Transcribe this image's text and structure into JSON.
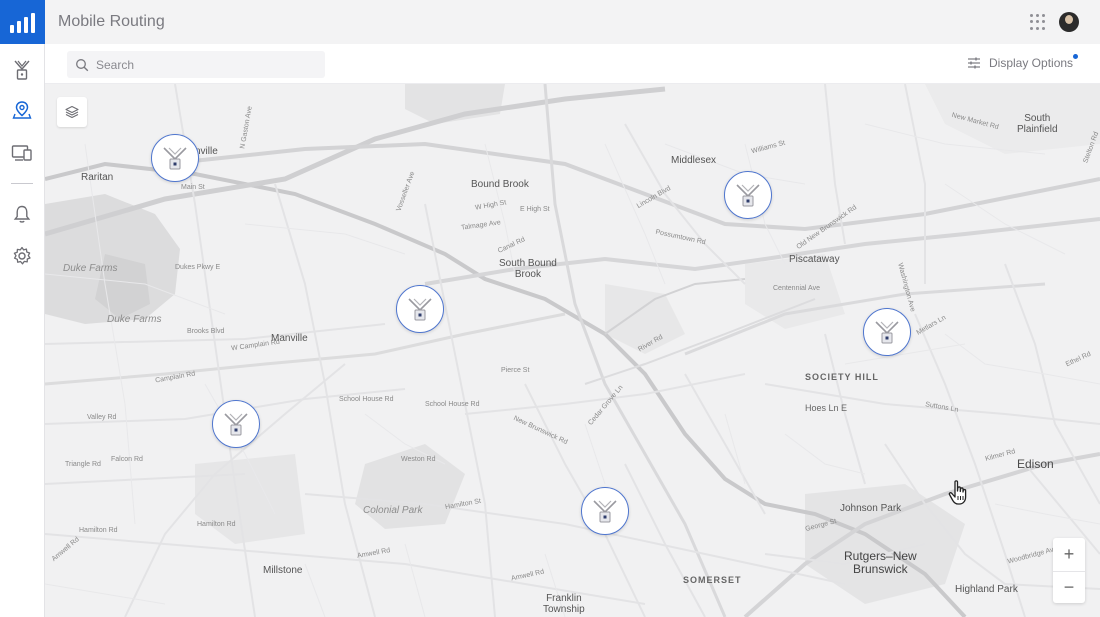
{
  "app": {
    "title": "Mobile Routing"
  },
  "brand": {
    "accent": "#1766d6",
    "marker_ring": "#4f76cf"
  },
  "sidebar": {
    "items": [
      {
        "name": "towers",
        "icon": "tower-icon"
      },
      {
        "name": "map",
        "icon": "map-pin-icon"
      },
      {
        "name": "devices",
        "icon": "devices-icon"
      },
      {
        "name": "alerts",
        "icon": "bell-icon"
      },
      {
        "name": "settings",
        "icon": "gear-icon"
      }
    ]
  },
  "header": {
    "apps_icon": "apps-grid-icon",
    "avatar": "user-avatar"
  },
  "toolbar": {
    "search_placeholder": "Search",
    "display_options_label": "Display Options"
  },
  "map": {
    "places": {
      "raritan": "Raritan",
      "manville_top": "nville",
      "bound_brook": "Bound Brook",
      "middlesex": "Middlesex",
      "south_plainfield": "South\nPlainfield",
      "south_bound_brook": "South Bound\nBrook",
      "piscataway": "Piscataway",
      "duke_farms_1": "Duke Farms",
      "duke_farms_2": "Duke Farms",
      "manville": "Manville",
      "society_hill": "SOCIETY HILL",
      "edison": "Edison",
      "colonial_park": "Colonial Park",
      "johnson_park": "Johnson Park",
      "rutgers": "Rutgers–New\nBrunswick",
      "millstone": "Millstone",
      "franklin": "Franklin\nTownship",
      "somerset": "SOMERSET",
      "highland_park": "Highland Park"
    },
    "streets": {
      "main_st": "Main St",
      "n_gaston": "N Gaston Ave",
      "e_high": "E High St",
      "w_high": "W High St",
      "talmage": "Talmage Ave",
      "canal_rd": "Canal Rd",
      "river_rd": "River Rd",
      "centennial": "Centennial Ave",
      "hoes_ln": "Hoes Ln E",
      "w_camplain": "W Camplain Rd",
      "camplain": "Camplain Rd",
      "valley_rd": "Valley Rd",
      "triangle": "Triangle Rd",
      "falcon": "Falcon Rd",
      "hamilton1": "Hamilton Rd",
      "hamilton2": "Hamilton Rd",
      "hamilton3": "Hamilton St",
      "amwell1": "Amwell Rd",
      "amwell2": "Amwell Rd",
      "amwell3": "Amwell Rd",
      "weston": "Weston Rd",
      "school_house1": "School House Rd",
      "school_house2": "School House Rd",
      "pierce": "Pierce St",
      "brooks_blvd": "Brooks Blvd",
      "new_brunswick_rd": "New Brunswick Rd",
      "kilmer": "Kilmer Rd",
      "woodbridge": "Woodbridge Ave",
      "new_market": "New Market Rd",
      "metlars": "Metlars Ln",
      "ethel": "Ethel Rd",
      "george": "George St",
      "dukes_pkwy": "Dukes Pkwy E",
      "lincoln": "Lincoln Blvd",
      "old_nb": "Old New Brunswick Rd",
      "stelton": "Stelton Rd",
      "possumtown": "Possumtown Rd",
      "suttons": "Suttons Ln",
      "cedar_grove": "Cedar Grove Ln",
      "williams": "Williams St",
      "washington": "Washington Ave",
      "vosseller": "Vosseller Ave"
    },
    "tower_icon": "cell-tower-icon",
    "layers_icon": "layers-icon"
  },
  "zoom": {
    "in_label": "+",
    "out_label": "−"
  }
}
